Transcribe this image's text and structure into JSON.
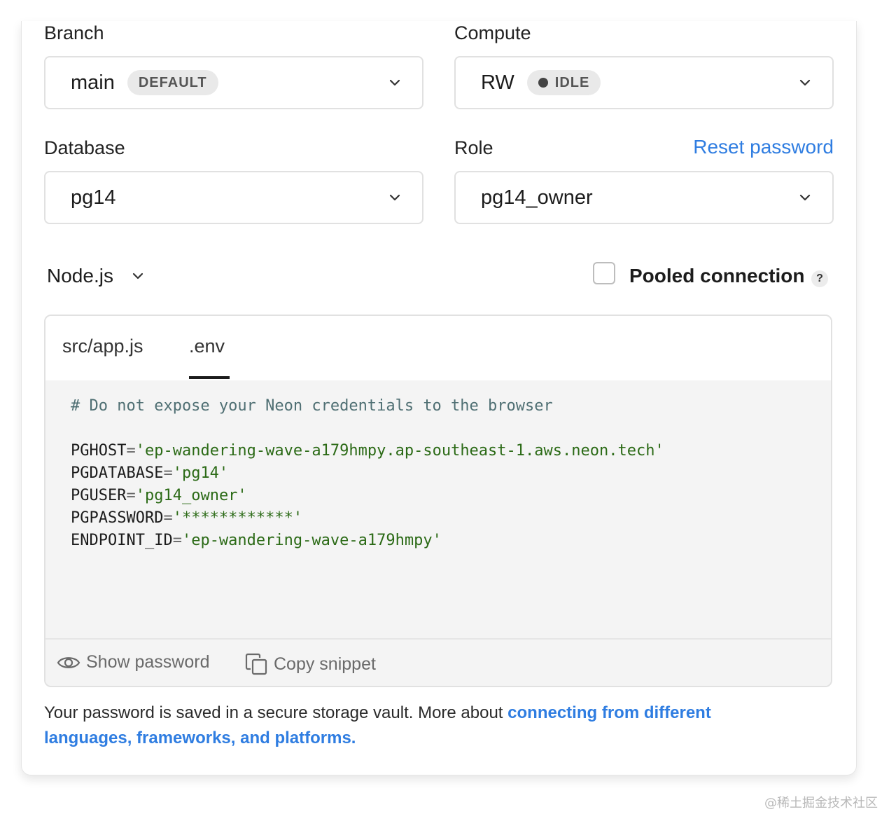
{
  "branch": {
    "label": "Branch",
    "value": "main",
    "badge": "DEFAULT"
  },
  "compute": {
    "label": "Compute",
    "value": "RW",
    "status": "IDLE"
  },
  "database": {
    "label": "Database",
    "value": "pg14"
  },
  "role": {
    "label": "Role",
    "value": "pg14_owner",
    "reset_link": "Reset password"
  },
  "language": {
    "value": "Node.js"
  },
  "pooled": {
    "label": "Pooled connection",
    "help": "?",
    "checked": false
  },
  "tabs": [
    {
      "label": "src/app.js",
      "active": false
    },
    {
      "label": ".env",
      "active": true
    }
  ],
  "code": {
    "comment": "# Do not expose your Neon credentials to the browser",
    "lines": [
      {
        "key": "PGHOST",
        "value": "'ep-wandering-wave-a179hmpy.ap-southeast-1.aws.neon.tech'"
      },
      {
        "key": "PGDATABASE",
        "value": "'pg14'"
      },
      {
        "key": "PGUSER",
        "value": "'pg14_owner'"
      },
      {
        "key": "PGPASSWORD",
        "value": "'************'"
      },
      {
        "key": "ENDPOINT_ID",
        "value": "'ep-wandering-wave-a179hmpy'"
      }
    ]
  },
  "actions": {
    "show_password": "Show password",
    "copy_snippet": "Copy snippet"
  },
  "note": {
    "text": "Your password is saved in a secure storage vault. More about ",
    "link": "connecting from different languages, frameworks, and platforms."
  },
  "watermark": "@稀土掘金技术社区",
  "colors": {
    "link": "#2f7de1",
    "string": "#2b6a16",
    "comment": "#4f6f73"
  }
}
